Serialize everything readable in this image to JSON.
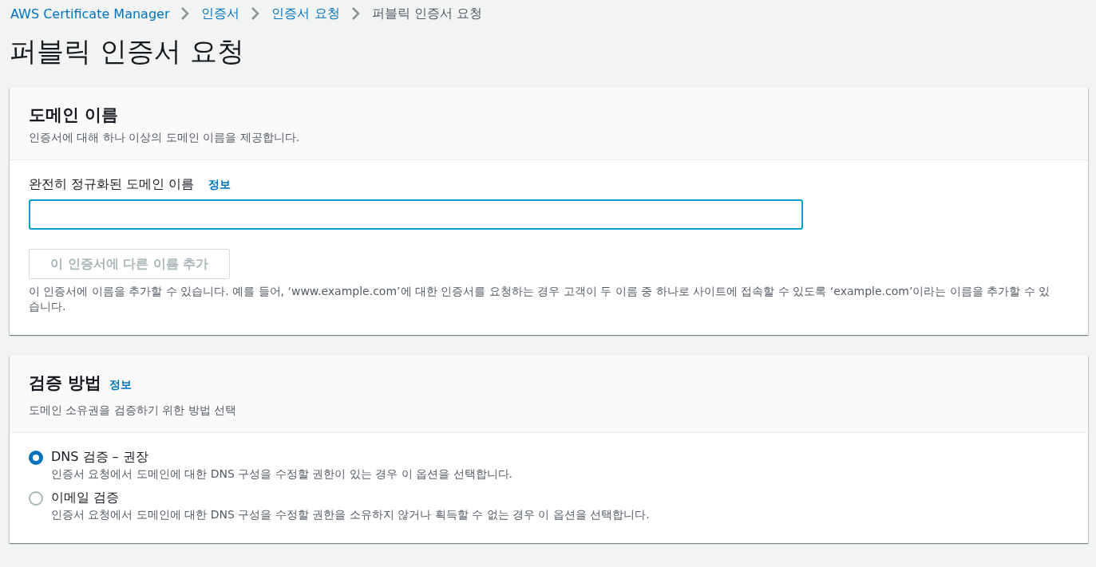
{
  "breadcrumbs": [
    {
      "label": "AWS Certificate Manager",
      "kind": "link"
    },
    {
      "label": "인증서",
      "kind": "link"
    },
    {
      "label": "인증서 요청",
      "kind": "link"
    },
    {
      "label": "퍼블릭 인증서 요청",
      "kind": "current"
    }
  ],
  "title": "퍼블릭 인증서 요청",
  "domain_panel": {
    "title": "도메인 이름",
    "description": "인증서에 대해 하나 이상의 도메인 이름을 제공합니다.",
    "field_label": "완전히 정규화된 도메인 이름",
    "info": "정보",
    "field_focused": true,
    "add_button": {
      "label": "이 인증서에 다른 이름 추가",
      "disabled": true
    },
    "hint": "이 인증서에 이름을 추가할 수 있습니다. 예를 들어, ‘www.example.com’에 대한 인증서를 요청하는 경우 고객이 두 이름 중 하나로 사이트에 접속할 수 있도록 ‘example.com’이라는 이름을 추가할 수 있습니다."
  },
  "validation_panel": {
    "title": "검증 방법",
    "info": "정보",
    "description": "도메인 소유권을 검증하기 위한 방법 선택",
    "options": [
      {
        "label": "DNS 검증 – 권장",
        "description": "인증서 요청에서 도메인에 대한 DNS 구성을 수정할 권한이 있는 경우 이 옵션을 선택합니다.",
        "selected": true
      },
      {
        "label": "이메일 검증",
        "description": "인증서 요청에서 도메인에 대한 DNS 구성을 수정할 권한을 소유하지 않거나 획득할 수 없는 경우 이 옵션을 선택합니다.",
        "selected": false
      }
    ]
  }
}
